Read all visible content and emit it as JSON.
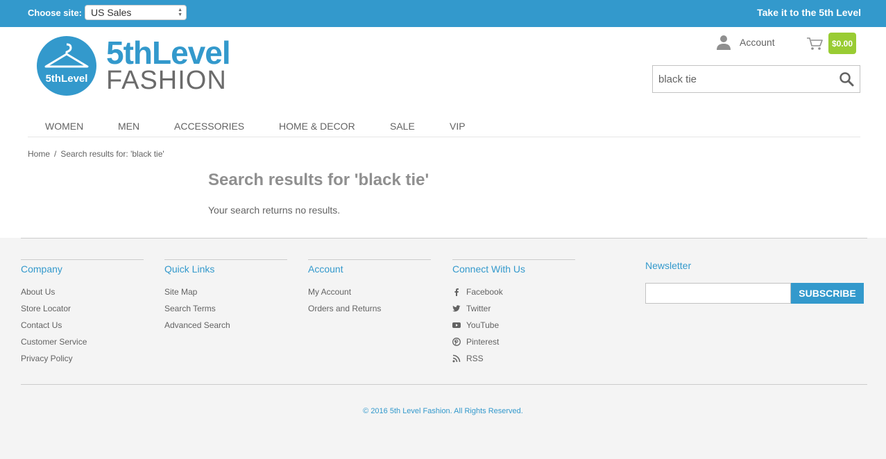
{
  "topbar": {
    "choose_site_label": "Choose site:",
    "site_selected": "US Sales",
    "tagline": "Take it to the 5th Level"
  },
  "logo": {
    "badge_text": "5thLevel",
    "line1": "5thLevel",
    "line2": "FASHION"
  },
  "header": {
    "account_label": "Account",
    "cart_total": "$0.00",
    "search_value": "black tie"
  },
  "nav": {
    "items": [
      "WOMEN",
      "MEN",
      "ACCESSORIES",
      "HOME & DECOR",
      "SALE",
      "VIP"
    ]
  },
  "breadcrumb": {
    "home": "Home",
    "separator": "/",
    "current": "Search results for: 'black tie'"
  },
  "main": {
    "title": "Search results for 'black tie'",
    "message": "Your search returns no results."
  },
  "footer": {
    "columns": [
      {
        "title": "Company",
        "links": [
          "About Us",
          "Store Locator",
          "Contact Us",
          "Customer Service",
          "Privacy Policy"
        ]
      },
      {
        "title": "Quick Links",
        "links": [
          "Site Map",
          "Search Terms",
          "Advanced Search"
        ]
      },
      {
        "title": "Account",
        "links": [
          "My Account",
          "Orders and Returns"
        ]
      },
      {
        "title": "Connect With Us",
        "links": [
          "Facebook",
          "Twitter",
          "YouTube",
          "Pinterest",
          "RSS"
        ],
        "icons": [
          "facebook-icon",
          "twitter-icon",
          "youtube-icon",
          "pinterest-icon",
          "rss-icon"
        ]
      }
    ],
    "newsletter": {
      "title": "Newsletter",
      "button": "SUBSCRIBE"
    },
    "copyright": "© 2016 5th Level Fashion. All Rights Reserved."
  },
  "colors": {
    "brand_blue": "#3399cc",
    "cart_green": "#99cc33",
    "text_gray": "#636363"
  }
}
